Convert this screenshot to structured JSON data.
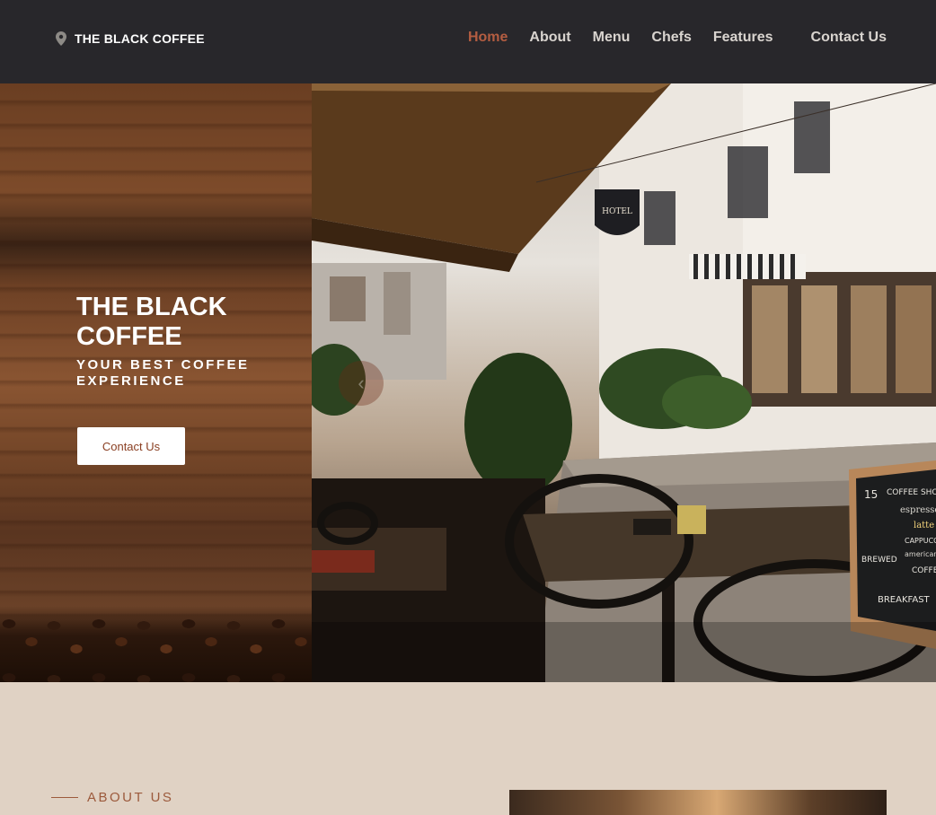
{
  "brand": {
    "name": "THE BLACK COFFEE",
    "icon": "map-pin-icon"
  },
  "nav": {
    "items": [
      "Home",
      "About",
      "Menu",
      "Chefs",
      "Features"
    ],
    "contact": "Contact Us",
    "active": "Home"
  },
  "hero": {
    "title": "THE BLACK COFFEE",
    "subtitle": "YOUR BEST COFFEE EXPERIENCE",
    "button": "Contact Us",
    "prev_icon": "chevron-left-icon"
  },
  "photo_signs": {
    "hotel_sign": "HOTEL",
    "board_title": "COFFEE SHOP",
    "board_number": "15",
    "board_items": [
      "espresso",
      "latte",
      "CAPPUCCINO",
      "americano",
      "BREWED",
      "COFFEE",
      "BREAKFAST"
    ]
  },
  "about": {
    "label": "ABOUT US"
  },
  "colors": {
    "nav_bg": "#28272b",
    "accent": "#b45d41",
    "page_bg": "#e0d2c4",
    "button_text": "#8a3f22"
  }
}
